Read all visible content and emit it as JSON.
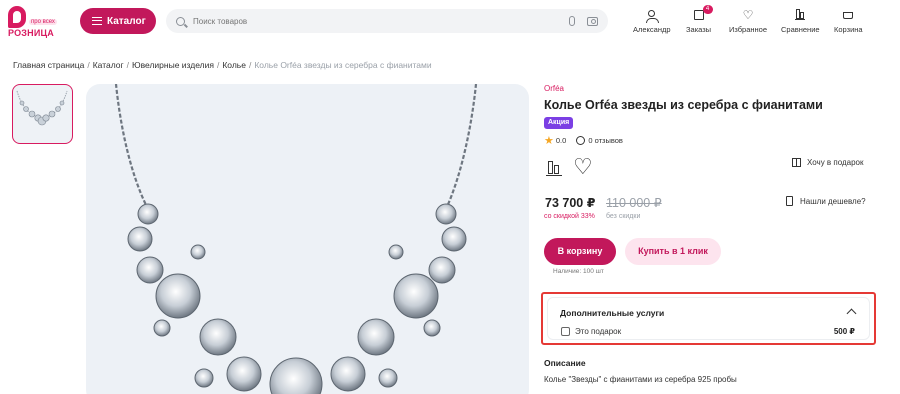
{
  "logo": {
    "tag": "про всех",
    "name": "РОЗНИЦА"
  },
  "header": {
    "catalog_label": "Каталог",
    "search_placeholder": "Поиск товаров",
    "nav": {
      "user": "Александр",
      "orders": "Заказы",
      "orders_badge": "4",
      "favorites": "Избранное",
      "compare": "Сравнение",
      "cart": "Корзина"
    }
  },
  "breadcrumb": {
    "items": [
      "Главная страница",
      "Каталог",
      "Ювелирные изделия",
      "Колье"
    ],
    "current": "Колье Orféa звезды из серебра с фианитами"
  },
  "product": {
    "brand": "Orféa",
    "title": "Колье Orféa звезды из серебра с фианитами",
    "promo_badge": "Акция",
    "rating": "0.0",
    "reviews": "0 отзывов",
    "gift_label": "Хочу в подарок",
    "cheaper_label": "Нашли дешевле?",
    "price": "73 700 ₽",
    "old_price": "110 000 ₽",
    "discount_label": "со скидкой 33%",
    "no_discount_label": "без скидки",
    "add_to_cart": "В корзину",
    "buy_one_click": "Купить в 1 клик",
    "stock": "Наличие: 100 шт"
  },
  "services": {
    "title": "Дополнительные услуги",
    "option_label": "Это подарок",
    "option_price": "500 ₽"
  },
  "description": {
    "heading": "Описание",
    "text": "Колье \"Звезды\" с фианитами из серебра 925 пробы"
  },
  "colors": {
    "accent": "#c2185b",
    "promo": "#7b3fe4",
    "highlight": "#e53935"
  }
}
